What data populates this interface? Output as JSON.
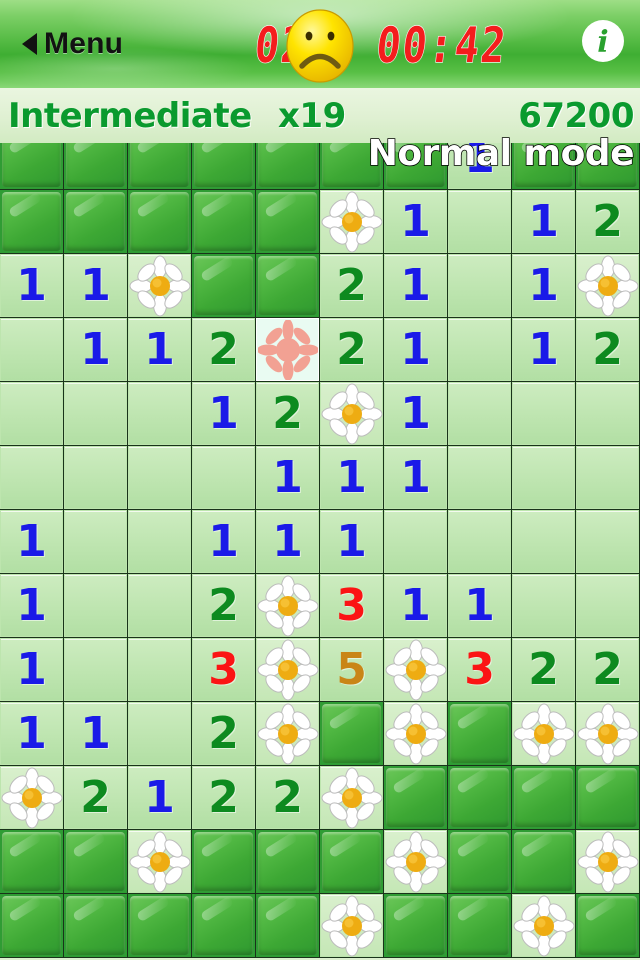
{
  "topbar": {
    "menu_label": "Menu",
    "menu_arrow_icon": "left-triangle-icon",
    "mine_count": "027",
    "timer": "00:42",
    "face_icon": "sad-face-icon",
    "info_icon": "info-icon",
    "info_label": "i"
  },
  "status": {
    "difficulty": "Intermediate",
    "multiplier": "x19",
    "score": "67200"
  },
  "overlay": {
    "mode_label": "Normal mode"
  },
  "colors": {
    "topbar_green": "#3fae33",
    "lcd_red": "#f41d1d",
    "score_green": "#0a9a2e",
    "covered_tile": "#3da834",
    "open_tile": "#bde5ae",
    "n1": "#1a1ae8",
    "n2": "#0d8a1f",
    "n3": "#fb1414",
    "n5": "#c98516",
    "mine_pink": "#f2a193"
  },
  "board": {
    "columns": 10,
    "rows": 13,
    "cell_size": 64,
    "legend": {
      "c": "covered",
      "o": "open-empty",
      "f": "flag-daisy",
      "m": "mine-starburst",
      "1-8": "number"
    },
    "cells": [
      [
        "c",
        "c",
        "c",
        "c",
        "c",
        "c",
        "c",
        "1",
        "c",
        "c"
      ],
      [
        "c",
        "c",
        "c",
        "c",
        "c",
        "f",
        "1",
        "o",
        "1",
        "2"
      ],
      [
        "1",
        "1",
        "f",
        "c",
        "c",
        "2",
        "1",
        "o",
        "1",
        "f"
      ],
      [
        "o",
        "1",
        "1",
        "2",
        "m",
        "2",
        "1",
        "o",
        "1",
        "2"
      ],
      [
        "o",
        "o",
        "o",
        "1",
        "2",
        "f",
        "1",
        "o",
        "o",
        "o"
      ],
      [
        "o",
        "o",
        "o",
        "o",
        "1",
        "1",
        "1",
        "o",
        "o",
        "o"
      ],
      [
        "1",
        "o",
        "o",
        "1",
        "1",
        "1",
        "o",
        "o",
        "o",
        "o"
      ],
      [
        "1",
        "o",
        "o",
        "2",
        "f",
        "3",
        "1",
        "1",
        "o",
        "o"
      ],
      [
        "1",
        "o",
        "o",
        "3",
        "f",
        "5",
        "f",
        "3",
        "2",
        "2"
      ],
      [
        "1",
        "1",
        "o",
        "2",
        "f",
        "c",
        "f",
        "c",
        "f",
        "f"
      ],
      [
        "f",
        "2",
        "1",
        "2",
        "2",
        "f",
        "c",
        "c",
        "c",
        "c"
      ],
      [
        "c",
        "c",
        "f",
        "c",
        "c",
        "c",
        "f",
        "c",
        "c",
        "f"
      ],
      [
        "c",
        "c",
        "c",
        "c",
        "c",
        "f",
        "c",
        "c",
        "f",
        "c"
      ]
    ]
  }
}
